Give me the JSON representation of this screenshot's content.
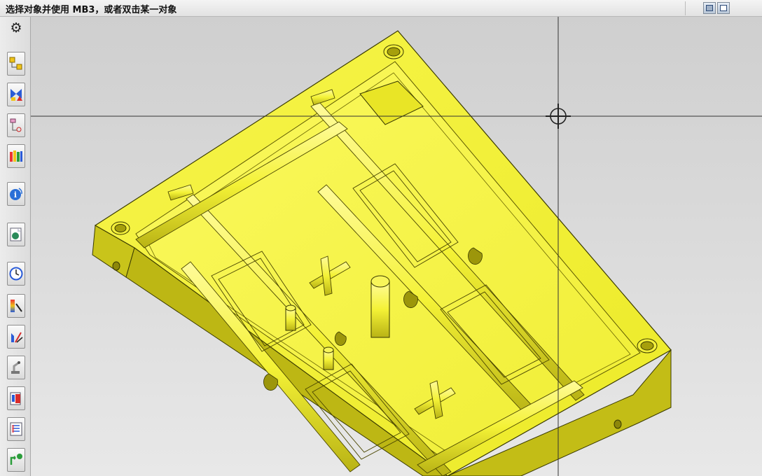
{
  "status_bar": {
    "prompt_text": "选择对象并使用 MB3，或者双击某一对象"
  },
  "colors": {
    "part_yellow": "#f2ef2e",
    "part_shadow": "#b4ae10",
    "viewport_bg": "#d6d6d6"
  },
  "toolbar_icons": [
    "settings-icon",
    "assembly-navigator-icon",
    "constraint-navigator-icon",
    "part-navigator-icon",
    "reuse-library-icon",
    "hd3d-tools-icon",
    "web-browser-icon",
    "history-icon",
    "process-studio-icon",
    "manufacturing-wizard-icon",
    "robot-simulation-icon",
    "roles-icon",
    "system-materials-icon",
    "data-exchange-icon"
  ]
}
